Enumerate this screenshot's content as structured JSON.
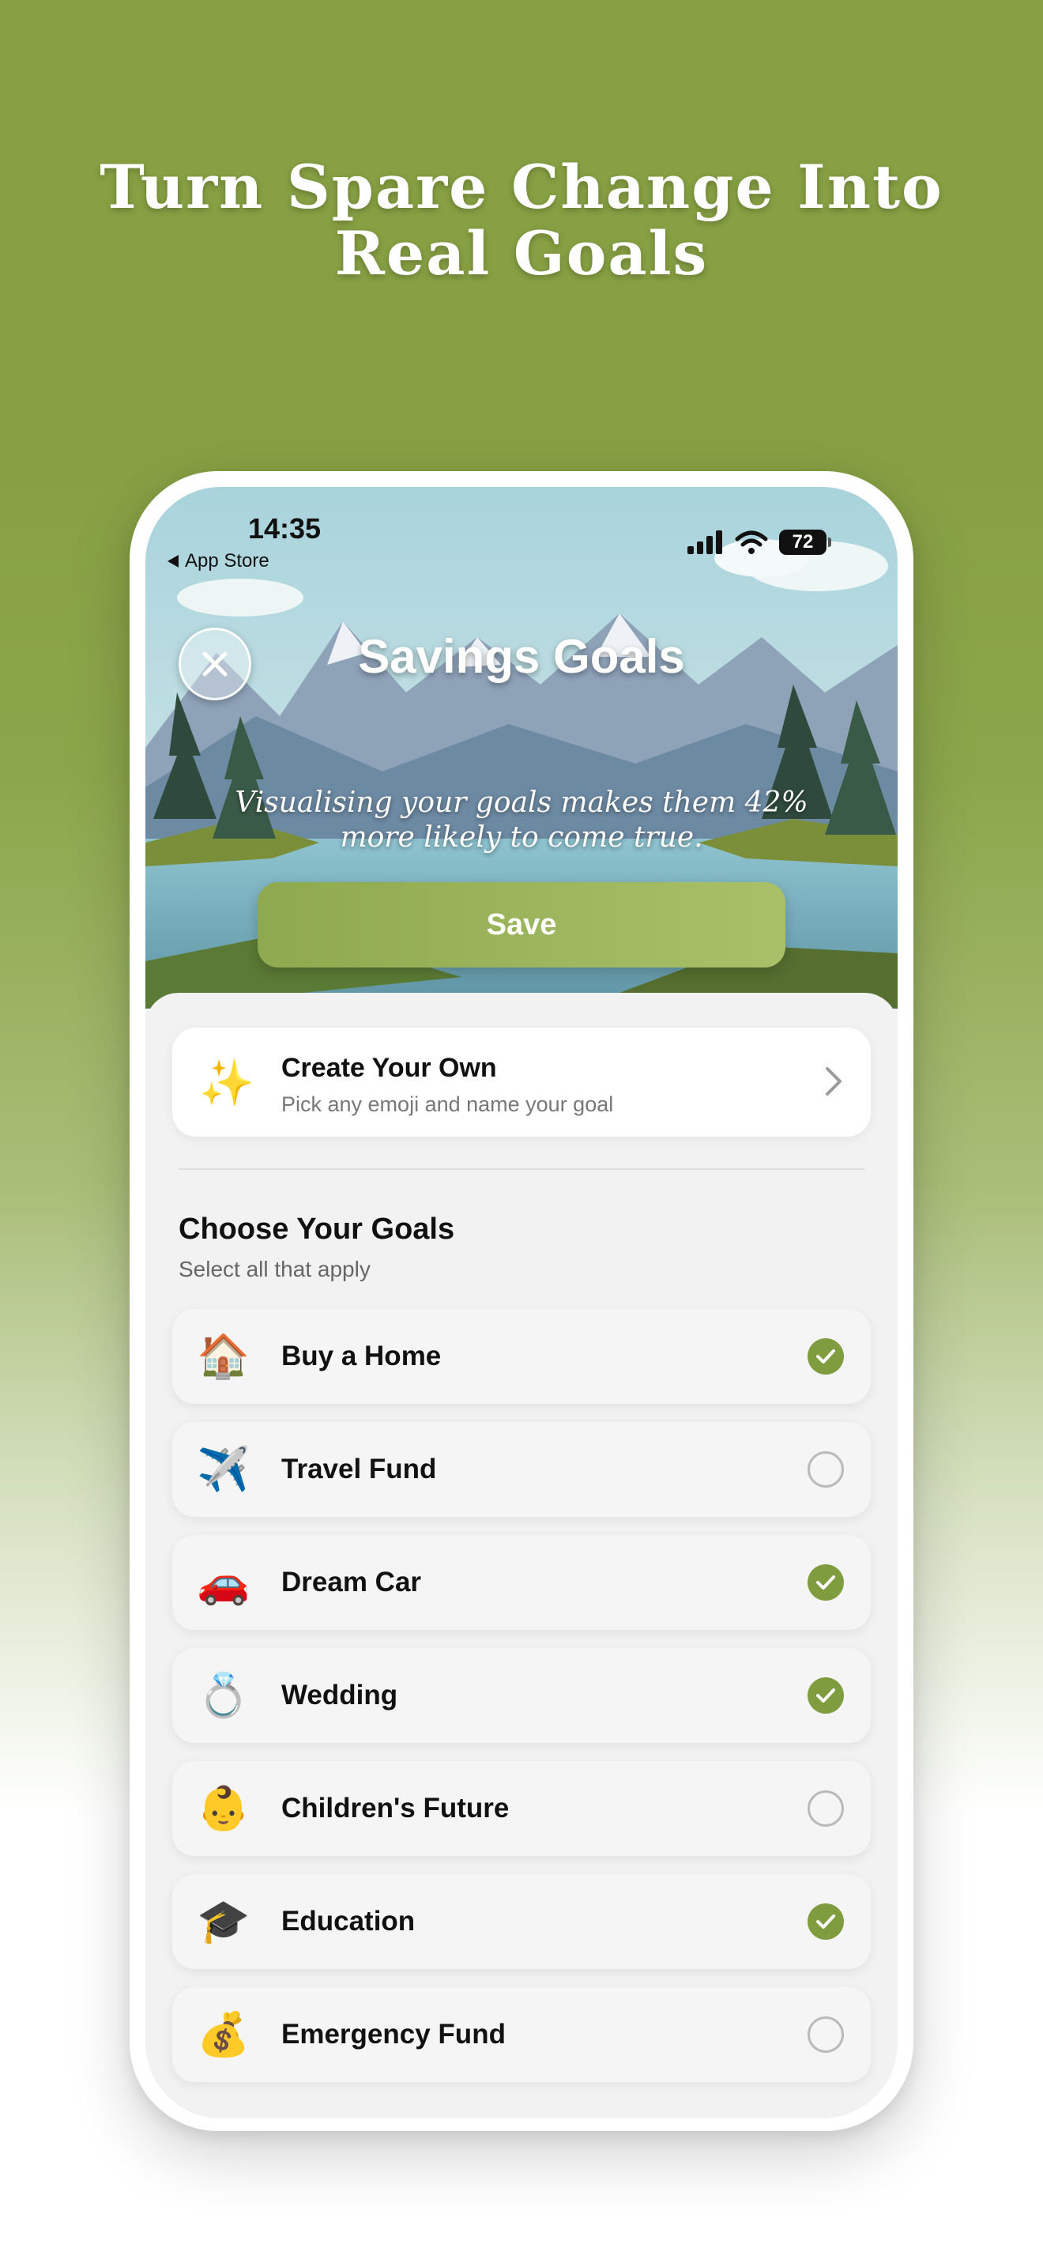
{
  "headline": "Turn Spare Change Into Real Goals",
  "status_bar": {
    "time": "14:35",
    "back_label": "App Store",
    "battery": "72"
  },
  "hero": {
    "title": "Savings Goals",
    "subtitle": "Visualising your goals makes them 42% more likely to come true.",
    "save_label": "Save"
  },
  "create_card": {
    "icon": "✨",
    "title": "Create Your Own",
    "subtitle": "Pick any emoji and name your goal"
  },
  "goals_section": {
    "title": "Choose Your Goals",
    "subtitle": "Select all that apply"
  },
  "goals": [
    {
      "emoji": "🏠",
      "label": "Buy a Home",
      "selected": true
    },
    {
      "emoji": "✈️",
      "label": "Travel Fund",
      "selected": false
    },
    {
      "emoji": "🚗",
      "label": "Dream Car",
      "selected": true
    },
    {
      "emoji": "💍",
      "label": "Wedding",
      "selected": true
    },
    {
      "emoji": "👶",
      "label": "Children's Future",
      "selected": false
    },
    {
      "emoji": "🎓",
      "label": "Education",
      "selected": true
    },
    {
      "emoji": "💰",
      "label": "Emergency Fund",
      "selected": false
    }
  ],
  "colors": {
    "brand_green": "#87a043",
    "check_green": "#7f9d3f",
    "save_gradient_start": "#8fa94f",
    "save_gradient_end": "#a9c068"
  }
}
